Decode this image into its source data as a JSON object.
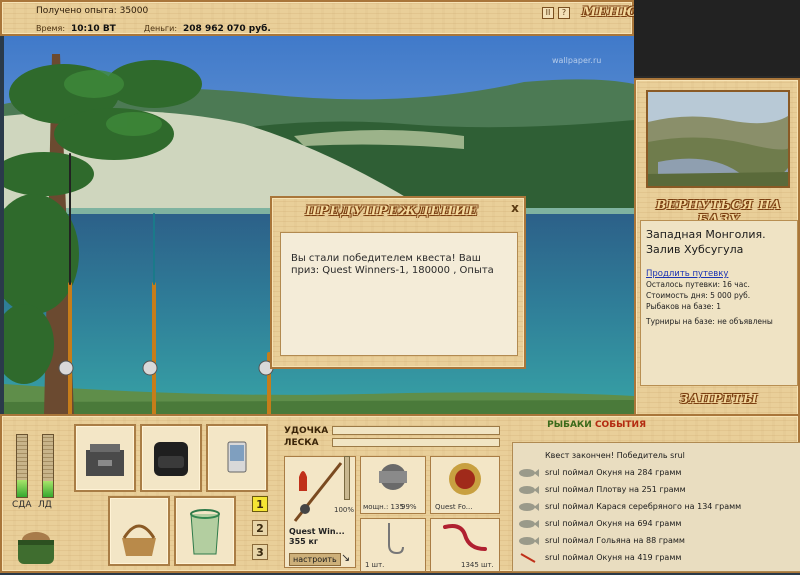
{
  "top": {
    "exp_text": "Получено опыта: 35000",
    "time_label": "Время:",
    "time_value": "10:10 ВТ",
    "money_label": "Деньги:",
    "money_value": "208 962 070 руб.",
    "btn_pause": "II",
    "btn_help": "?",
    "menu_label": "МЕНЮ"
  },
  "scene": {
    "watermark": "wallpaper.ru"
  },
  "right": {
    "return_label": "ВЕРНУТЬСЯ НА БАЗУ",
    "location": "Западная Монголия. Залив Хубсугула",
    "extend_link": "Продлить путевку",
    "remaining": "Осталось путевки: 16 час.",
    "day_cost": "Стоимость дня: 5 000 руб.",
    "anglers": "Рыбаков на базе: 1",
    "tournaments": "Турниры на базе: не объявлены",
    "bans_label": "ЗАПРЕТЫ"
  },
  "dialog": {
    "title": "ПРЕДУПРЕЖДЕНИЕ",
    "close": "x",
    "message": "Вы стали победителем квеста! Ваш приз: Quest Winners-1, 180000 , Опыта"
  },
  "gauges": {
    "left_label": "СДА",
    "right_label": "ЛД",
    "left_fill": 0.28,
    "right_fill": 0.26
  },
  "num_buttons": [
    "1",
    "2",
    "3"
  ],
  "rod": {
    "rod_label": "УДОЧКА",
    "line_label": "ЛЕСКА",
    "rod_name": "Quest Win...",
    "rod_weight": "355 кг",
    "rod_percent": "100%",
    "reel_power": "мощн.: 135",
    "reel_percent": "99%",
    "line_name": "Quest Fo...",
    "hook_count": "1 шт.",
    "bait_count": "1345 шт.",
    "configure": "настроить"
  },
  "events": {
    "tab_catch": "РЫБАКИ",
    "tab_events": "СОБЫТИЯ",
    "items": [
      "Квест закончен! Победитель srul",
      "srul поймал Окуня на 284 грамм",
      "srul поймал Плотву на 251 грамм",
      "srul поймал Карася серебряного на 134 грамм",
      "srul поймал Окуня на 694 грамм",
      "srul поймал Гольяна на 88 грамм",
      "srul поймал Окуня на 419 грамм"
    ]
  },
  "colors": {
    "wood": "#e9cf99",
    "frame": "#a9763a",
    "accent_red": "#b32a10",
    "link": "#1a33b3"
  }
}
